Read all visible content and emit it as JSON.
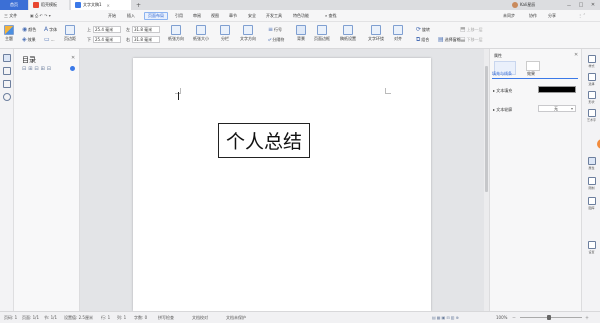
{
  "titlebar": {
    "home_tab": "首页",
    "tabs": [
      {
        "label": "稻壳模板",
        "color": "#e8462f"
      },
      {
        "label": "文字文稿1",
        "color": "#3b79e8"
      }
    ],
    "new_tab": "+",
    "user_name": "Kali星辰",
    "buttons": [
      "－",
      "□",
      "✕"
    ]
  },
  "menubar": {
    "file": "三 文件",
    "quick_icons": [
      "保存",
      "打印",
      "撤销",
      "恢复"
    ],
    "items": [
      "开始",
      "插入",
      "页面布局",
      "引用",
      "审阅",
      "视图",
      "章节",
      "安全",
      "开发工具",
      "特色功能"
    ],
    "active": "页面布局",
    "search": "查找",
    "right_items": [
      "未同步",
      "协作",
      "分享"
    ]
  },
  "toolbar": {
    "theme": "主题",
    "color": "颜色",
    "font": "字体",
    "effect": "效果",
    "margins": "页边距",
    "margin_top_label": "上",
    "margin_top": "25.4 毫米",
    "margin_bottom_label": "下",
    "margin_bottom": "25.4 毫米",
    "margin_left_label": "左",
    "margin_left": "31.8 毫米",
    "margin_right_label": "右",
    "margin_right": "31.8 毫米",
    "orientation": "纸张方向",
    "size": "纸张大小",
    "columns": "分栏",
    "text_direction": "文字方向",
    "line_numbers": "行号",
    "breaks": "分隔符",
    "background": "背景",
    "page_border": "页面边框",
    "manuscript": "稿纸设置",
    "wrap": "文字环绕",
    "align": "对齐",
    "rotate": "旋转",
    "group": "组合",
    "select_pane": "选择窗格",
    "up_layer": "上移一层",
    "down_layer": "下移一层"
  },
  "toc": {
    "title": "目录",
    "close": "✕"
  },
  "document": {
    "heading": "个人总结"
  },
  "props": {
    "title": "属性",
    "tabs": [
      "填充与线条",
      "效果"
    ],
    "section_fill": "文本填充",
    "fill_color": "#000000",
    "section_outline": "文本轮廓",
    "outline_value": "无"
  },
  "rightstrip": {
    "items": [
      "样式",
      "选择",
      "形状",
      "艺术字",
      "属性",
      "限制",
      "图库",
      "设置"
    ]
  },
  "statusbar": {
    "page_num": "页码: 1",
    "page": "页面: 1/1",
    "section": "节: 1/1",
    "setting": "设置值: 2.5厘米",
    "row": "行: 1",
    "col": "列: 1",
    "words": "字数: 0",
    "spell": "拼写检查",
    "proof": "文档校对",
    "unsaved": "文档未保护",
    "zoom": "100%",
    "zoom_minus": "－",
    "zoom_plus": "＋"
  }
}
